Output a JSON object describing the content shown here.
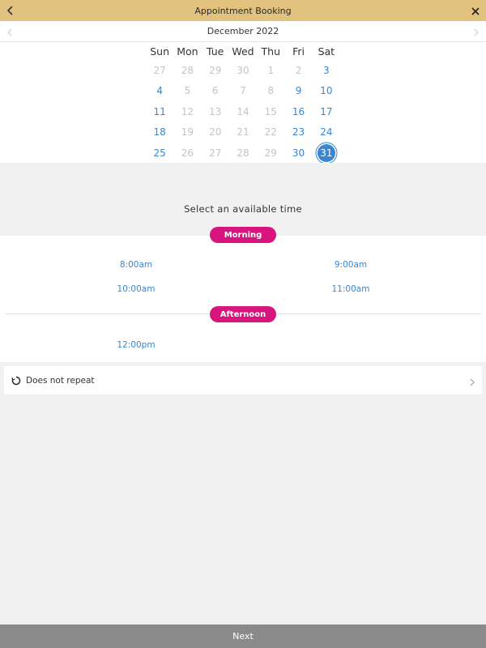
{
  "header": {
    "title": "Appointment Booking",
    "back_icon": "chevron-left-icon",
    "close_icon": "close-icon",
    "bg_color": "#e2c27f"
  },
  "calendar": {
    "month_label": "December 2022",
    "prev_icon": "chevron-left-icon",
    "next_icon": "chevron-right-icon",
    "weekdays": [
      "Sun",
      "Mon",
      "Tue",
      "Wed",
      "Thu",
      "Fri",
      "Sat"
    ],
    "weeks": [
      [
        {
          "d": "27",
          "s": "disabled"
        },
        {
          "d": "28",
          "s": "disabled"
        },
        {
          "d": "29",
          "s": "disabled"
        },
        {
          "d": "30",
          "s": "disabled"
        },
        {
          "d": "1",
          "s": "disabled"
        },
        {
          "d": "2",
          "s": "disabled"
        },
        {
          "d": "3",
          "s": "available"
        }
      ],
      [
        {
          "d": "4",
          "s": "available"
        },
        {
          "d": "5",
          "s": "disabled"
        },
        {
          "d": "6",
          "s": "disabled"
        },
        {
          "d": "7",
          "s": "disabled"
        },
        {
          "d": "8",
          "s": "disabled"
        },
        {
          "d": "9",
          "s": "available"
        },
        {
          "d": "10",
          "s": "available"
        }
      ],
      [
        {
          "d": "11",
          "s": "available"
        },
        {
          "d": "12",
          "s": "disabled"
        },
        {
          "d": "13",
          "s": "disabled"
        },
        {
          "d": "14",
          "s": "disabled"
        },
        {
          "d": "15",
          "s": "disabled"
        },
        {
          "d": "16",
          "s": "available"
        },
        {
          "d": "17",
          "s": "available"
        }
      ],
      [
        {
          "d": "18",
          "s": "available"
        },
        {
          "d": "19",
          "s": "disabled"
        },
        {
          "d": "20",
          "s": "disabled"
        },
        {
          "d": "21",
          "s": "disabled"
        },
        {
          "d": "22",
          "s": "disabled"
        },
        {
          "d": "23",
          "s": "available"
        },
        {
          "d": "24",
          "s": "available"
        }
      ],
      [
        {
          "d": "25",
          "s": "available"
        },
        {
          "d": "26",
          "s": "disabled"
        },
        {
          "d": "27",
          "s": "disabled"
        },
        {
          "d": "28",
          "s": "disabled"
        },
        {
          "d": "29",
          "s": "disabled"
        },
        {
          "d": "30",
          "s": "available"
        },
        {
          "d": "31",
          "s": "selected"
        }
      ]
    ],
    "available_color": "#3a86d1",
    "disabled_color": "#c4c4c4"
  },
  "time_selection": {
    "prompt": "Select an available time",
    "accent_color": "#d8157e",
    "morning": {
      "label": "Morning",
      "slots": [
        "8:00am",
        "9:00am",
        "10:00am",
        "11:00am"
      ]
    },
    "afternoon": {
      "label": "Afternoon",
      "slots": [
        "12:00pm"
      ]
    }
  },
  "repeat": {
    "icon": "repeat-icon",
    "label": "Does not repeat",
    "chevron_icon": "chevron-right-icon"
  },
  "footer": {
    "next_label": "Next"
  }
}
